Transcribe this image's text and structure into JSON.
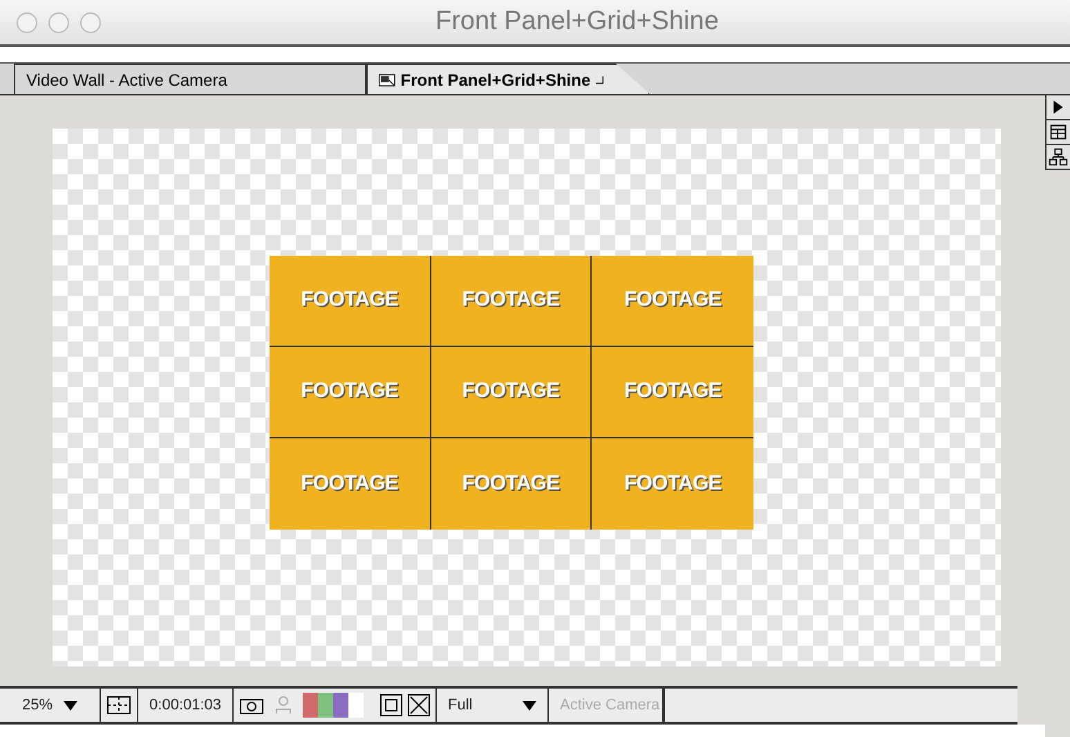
{
  "window": {
    "title": "Front Panel+Grid+Shine"
  },
  "tabs": [
    {
      "label": "Video Wall - Active Camera",
      "selected": false
    },
    {
      "label": "Front Panel+Grid+Shine",
      "selected": true
    }
  ],
  "grid": {
    "cells": [
      "FOOTAGE",
      "FOOTAGE",
      "FOOTAGE",
      "FOOTAGE",
      "FOOTAGE",
      "FOOTAGE",
      "FOOTAGE",
      "FOOTAGE",
      "FOOTAGE"
    ]
  },
  "toolbar": {
    "magnification": "25%",
    "timecode": "0:00:01:03",
    "resolution": "Full",
    "camera": {
      "label": "Active Camera",
      "disabled": true
    }
  }
}
